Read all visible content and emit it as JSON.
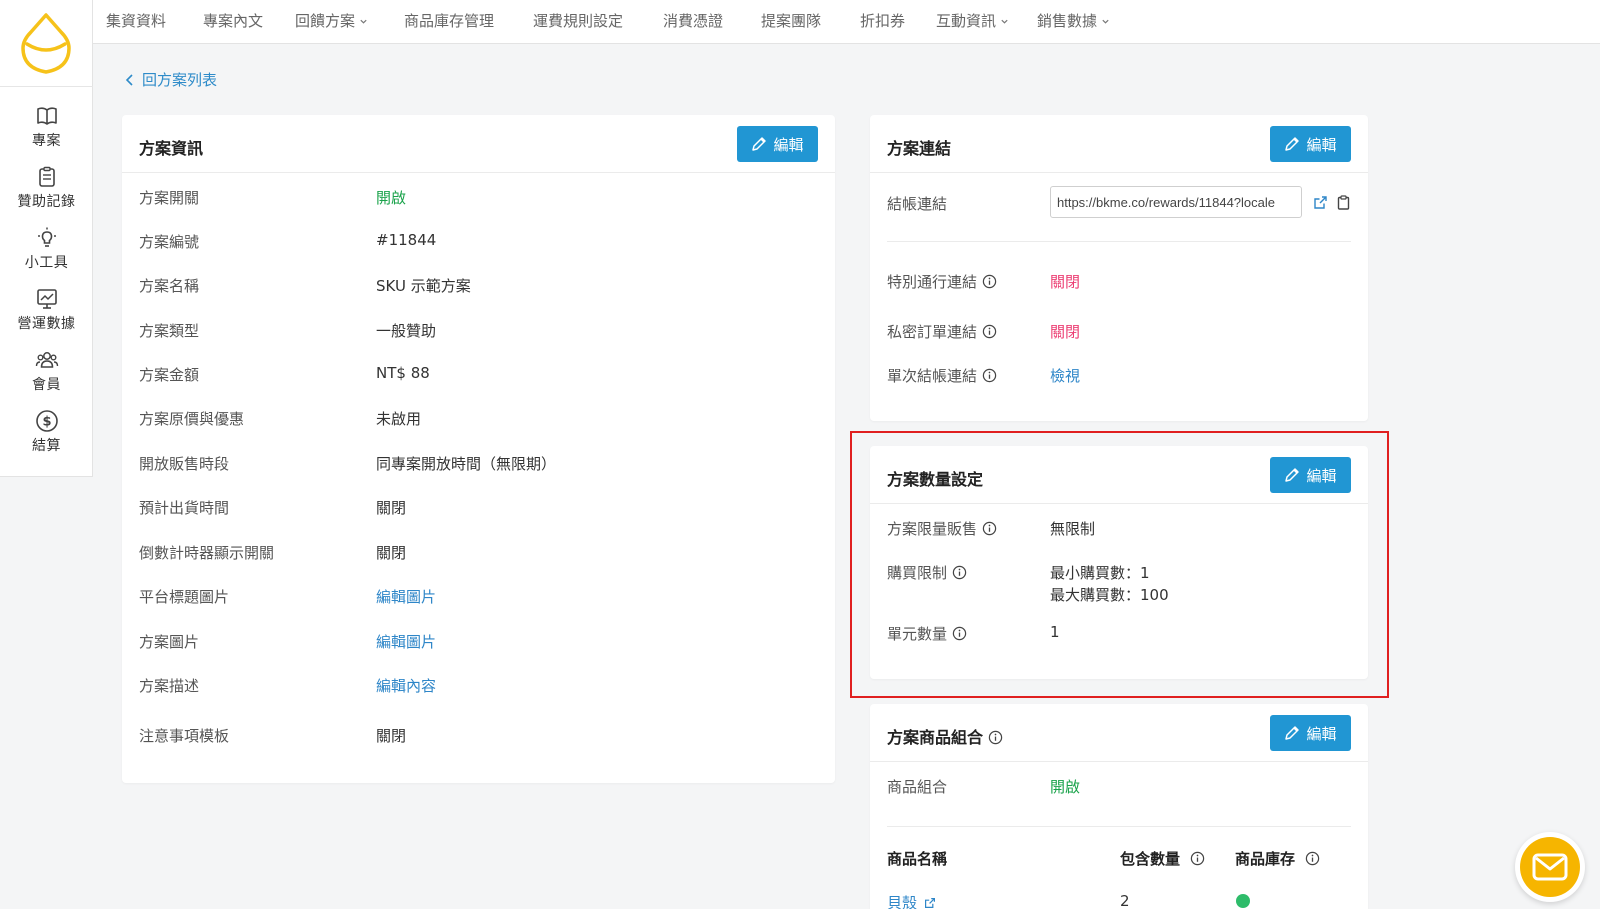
{
  "sidebar": {
    "items": [
      {
        "label": "專案",
        "icon": "book-icon"
      },
      {
        "label": "贊助記錄",
        "icon": "clipboard-icon"
      },
      {
        "label": "小工具",
        "icon": "lightbulb-icon"
      },
      {
        "label": "營運數據",
        "icon": "chart-icon"
      },
      {
        "label": "會員",
        "icon": "members-icon"
      },
      {
        "label": "結算",
        "icon": "dollar-icon"
      }
    ]
  },
  "topnav": {
    "items": [
      {
        "label": "集資資料"
      },
      {
        "label": "專案內文"
      },
      {
        "label": "回饋方案"
      },
      {
        "label": "商品庫存管理"
      },
      {
        "label": "運費規則設定"
      },
      {
        "label": "消費憑證"
      },
      {
        "label": "提案團隊"
      },
      {
        "label": "折扣券"
      },
      {
        "label": "互動資訊"
      },
      {
        "label": "銷售數據"
      }
    ]
  },
  "back_link": "回方案列表",
  "edit_label": "編輯",
  "plan_info": {
    "title": "方案資訊",
    "rows": [
      {
        "label": "方案開關",
        "value": "開啟"
      },
      {
        "label": "方案編號",
        "value": "#11844"
      },
      {
        "label": "方案名稱",
        "value": "SKU 示範方案"
      },
      {
        "label": "方案類型",
        "value": "一般贊助"
      },
      {
        "label": "方案金額",
        "value": "NT$ 88"
      },
      {
        "label": "方案原價與優惠",
        "value": "未啟用"
      },
      {
        "label": "開放販售時段",
        "value": "同專案開放時間（無限期）"
      },
      {
        "label": "預計出貨時間",
        "value": "關閉"
      },
      {
        "label": "倒數計時器顯示開關",
        "value": "關閉"
      },
      {
        "label": "平台標題圖片",
        "value": "編輯圖片"
      },
      {
        "label": "方案圖片",
        "value": "編輯圖片"
      },
      {
        "label": "方案描述",
        "value": "編輯內容"
      },
      {
        "label": "注意事項模板",
        "value": "關閉"
      }
    ]
  },
  "plan_link": {
    "title": "方案連結",
    "checkout_label": "結帳連結",
    "checkout_url": "https://bkme.co/rewards/11844?locale",
    "special_label": "特別通行連結",
    "special_value": "關閉",
    "private_label": "私密訂單連結",
    "private_value": "關閉",
    "single_label": "單次結帳連結",
    "single_value": "檢視"
  },
  "qty_settings": {
    "title": "方案數量設定",
    "limit_label": "方案限量販售",
    "limit_value": "無限制",
    "purchase_label": "購買限制",
    "purchase_min": "最小購買數：1",
    "purchase_max": "最大購買數：100",
    "unit_label": "單元數量",
    "unit_value": "1"
  },
  "bundle": {
    "title": "方案商品組合",
    "combo_label": "商品組合",
    "combo_value": "開啟",
    "col_name": "商品名稱",
    "col_qty": "包含數量",
    "col_stock": "商品庫存",
    "rows": [
      {
        "name": "貝殼",
        "qty": "2",
        "stock_color": "#2ebc6a"
      }
    ]
  },
  "colors": {
    "accent": "#2196d3",
    "green": "#19a24a",
    "pink": "#ec3e73",
    "highlight": "#e02020",
    "chat": "#f6b500"
  }
}
